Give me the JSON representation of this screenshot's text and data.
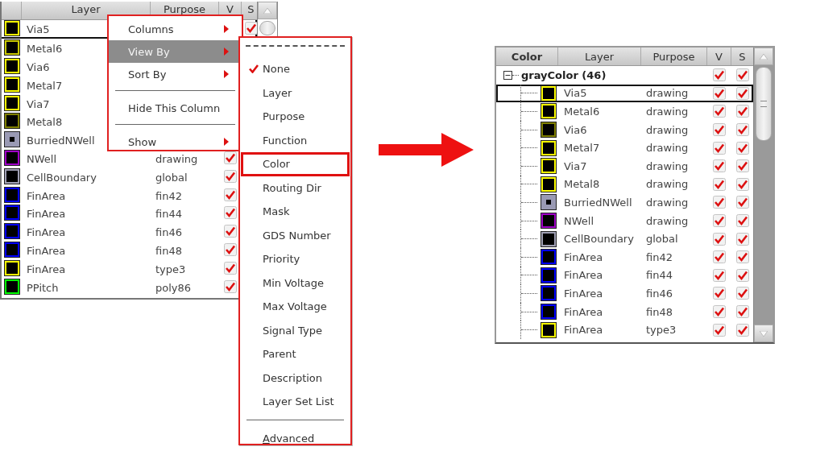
{
  "left_panel": {
    "columns": [
      {
        "label": "Layer"
      },
      {
        "label": "Purpose"
      },
      {
        "label": "V"
      },
      {
        "label": "S"
      }
    ],
    "rows": [
      {
        "layer": "Via5",
        "color": "#ffff00",
        "kind": "outline",
        "selected": true,
        "s": true
      },
      {
        "layer": "Metal6",
        "color": "#c8c800",
        "kind": "outline",
        "selected": false
      },
      {
        "layer": "Via6",
        "color": "#ffff00",
        "kind": "outline",
        "selected": false
      },
      {
        "layer": "Metal7",
        "color": "#ffff00",
        "kind": "outline",
        "selected": false
      },
      {
        "layer": "Via7",
        "color": "#ffff00",
        "kind": "outline",
        "selected": false
      },
      {
        "layer": "Metal8",
        "color": "#808000",
        "kind": "outline",
        "selected": false
      },
      {
        "layer": "BurriedNWell",
        "color": "#9a9ab4",
        "kind": "solid",
        "selected": false
      },
      {
        "layer": "NWell",
        "purpose": "drawing",
        "color": "#a000c8",
        "kind": "outline",
        "selected": false,
        "v": true
      },
      {
        "layer": "CellBoundary",
        "purpose": "global",
        "color": "#a0a0b4",
        "kind": "outline",
        "selected": false,
        "v": true
      },
      {
        "layer": "FinArea",
        "purpose": "fin42",
        "color": "#0000ff",
        "kind": "outline",
        "selected": false,
        "v": true
      },
      {
        "layer": "FinArea",
        "purpose": "fin44",
        "color": "#0000ff",
        "kind": "outline",
        "selected": false,
        "v": true
      },
      {
        "layer": "FinArea",
        "purpose": "fin46",
        "color": "#0000ff",
        "kind": "outline",
        "selected": false,
        "v": true
      },
      {
        "layer": "FinArea",
        "purpose": "fin48",
        "color": "#0000ff",
        "kind": "outline",
        "selected": false,
        "v": true
      },
      {
        "layer": "FinArea",
        "purpose": "type3",
        "color": "#ffff00",
        "kind": "outline",
        "selected": false,
        "v": true
      },
      {
        "layer": "PPitch",
        "purpose": "poly86",
        "color": "#00ff00",
        "kind": "outline",
        "selected": false,
        "v": true
      }
    ]
  },
  "context_menu": {
    "items": [
      {
        "kind": "item",
        "label": "Columns",
        "submenu": true,
        "highlighted": false
      },
      {
        "kind": "item",
        "label": "View By",
        "submenu": true,
        "highlighted": true
      },
      {
        "kind": "item",
        "label": "Sort By",
        "submenu": true,
        "highlighted": false
      },
      {
        "kind": "separator"
      },
      {
        "kind": "item",
        "label": "Hide This Column",
        "submenu": false,
        "highlighted": false
      },
      {
        "kind": "separator"
      },
      {
        "kind": "item",
        "label": "Show",
        "submenu": true,
        "highlighted": false
      }
    ]
  },
  "view_by_menu": {
    "items": [
      {
        "kind": "tearoff"
      },
      {
        "kind": "item",
        "label": "None",
        "checked": true,
        "outlined": false
      },
      {
        "kind": "item",
        "label": "Layer",
        "checked": false,
        "outlined": false
      },
      {
        "kind": "item",
        "label": "Purpose",
        "checked": false,
        "outlined": false
      },
      {
        "kind": "item",
        "label": "Function",
        "checked": false,
        "outlined": false
      },
      {
        "kind": "item",
        "label": "Color",
        "checked": false,
        "outlined": true
      },
      {
        "kind": "item",
        "label": "Routing Dir",
        "checked": false,
        "outlined": false
      },
      {
        "kind": "item",
        "label": "Mask",
        "checked": false,
        "outlined": false
      },
      {
        "kind": "item",
        "label": "GDS Number",
        "checked": false,
        "outlined": false
      },
      {
        "kind": "item",
        "label": "Priority",
        "checked": false,
        "outlined": false
      },
      {
        "kind": "item",
        "label": "Min Voltage",
        "checked": false,
        "outlined": false
      },
      {
        "kind": "item",
        "label": "Max Voltage",
        "checked": false,
        "outlined": false
      },
      {
        "kind": "item",
        "label": "Signal Type",
        "checked": false,
        "outlined": false
      },
      {
        "kind": "item",
        "label": "Parent",
        "checked": false,
        "outlined": false
      },
      {
        "kind": "item",
        "label": "Description",
        "checked": false,
        "outlined": false
      },
      {
        "kind": "item",
        "label": "Layer Set List",
        "checked": false,
        "outlined": false
      },
      {
        "kind": "separator"
      },
      {
        "kind": "item",
        "label": "Advanced",
        "checked": false,
        "outlined": false,
        "mnemonic_underlined": true
      }
    ]
  },
  "right_panel": {
    "columns": [
      {
        "label": "Color"
      },
      {
        "label": "Layer"
      },
      {
        "label": "Purpose"
      },
      {
        "label": "V"
      },
      {
        "label": "S"
      }
    ],
    "groups": [
      {
        "label": "grayColor (46)",
        "expanded": true,
        "v": true,
        "s": true,
        "children": [
          {
            "layer": "Via5",
            "purpose": "drawing",
            "color": "#ffff00",
            "kind": "outline",
            "selected": true,
            "v": true,
            "s": true
          },
          {
            "layer": "Metal6",
            "purpose": "drawing",
            "color": "#ffff00",
            "kind": "outline",
            "selected": false,
            "v": true,
            "s": true
          },
          {
            "layer": "Via6",
            "purpose": "drawing",
            "color": "#808000",
            "kind": "outline",
            "selected": false,
            "v": true,
            "s": true
          },
          {
            "layer": "Metal7",
            "purpose": "drawing",
            "color": "#ffff00",
            "kind": "outline",
            "selected": false,
            "v": true,
            "s": true
          },
          {
            "layer": "Via7",
            "purpose": "drawing",
            "color": "#ffff00",
            "kind": "outline",
            "selected": false,
            "v": true,
            "s": true
          },
          {
            "layer": "Metal8",
            "purpose": "drawing",
            "color": "#ffff00",
            "kind": "outline",
            "selected": false,
            "v": true,
            "s": true
          },
          {
            "layer": "BurriedNWell",
            "purpose": "drawing",
            "color": "#9a9ab4",
            "kind": "solid",
            "selected": false,
            "v": true,
            "s": true
          },
          {
            "layer": "NWell",
            "purpose": "drawing",
            "color": "#a000c8",
            "kind": "outline",
            "selected": false,
            "v": true,
            "s": true
          },
          {
            "layer": "CellBoundary",
            "purpose": "global",
            "color": "#a0a0b4",
            "kind": "outline",
            "selected": false,
            "v": true,
            "s": true
          },
          {
            "layer": "FinArea",
            "purpose": "fin42",
            "color": "#0000ff",
            "kind": "outline",
            "selected": false,
            "v": true,
            "s": true
          },
          {
            "layer": "FinArea",
            "purpose": "fin44",
            "color": "#0000ff",
            "kind": "outline",
            "selected": false,
            "v": true,
            "s": true
          },
          {
            "layer": "FinArea",
            "purpose": "fin46",
            "color": "#0000ff",
            "kind": "outline",
            "selected": false,
            "v": true,
            "s": true
          },
          {
            "layer": "FinArea",
            "purpose": "fin48",
            "color": "#0000ff",
            "kind": "outline",
            "selected": false,
            "v": true,
            "s": true
          },
          {
            "layer": "FinArea",
            "purpose": "type3",
            "color": "#ffff00",
            "kind": "outline",
            "selected": false,
            "v": true,
            "s": true
          }
        ]
      }
    ]
  }
}
